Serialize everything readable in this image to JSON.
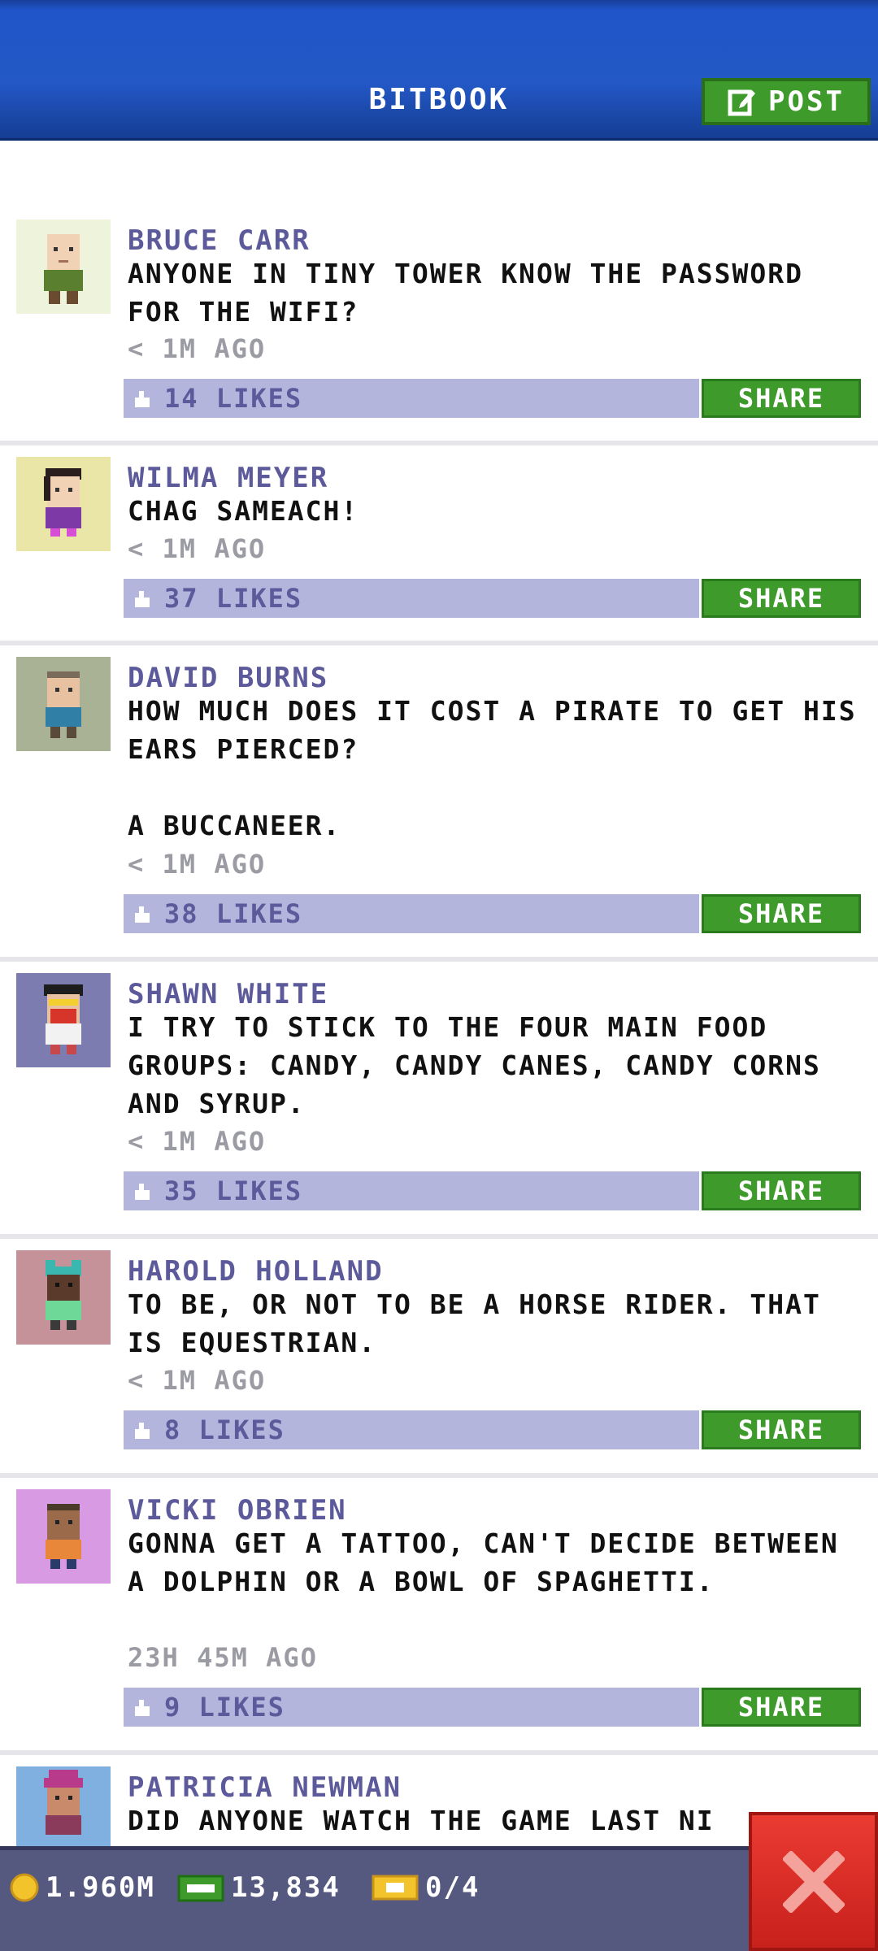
{
  "header": {
    "title": "BITBOOK",
    "post_label": "POST"
  },
  "posts": [
    {
      "name": "BRUCE CARR",
      "text": "ANYONE IN TINY TOWER KNOW THE PASSWORD FOR THE WIFI?",
      "time": "< 1M AGO",
      "likes": "14 LIKES",
      "share": "SHARE"
    },
    {
      "name": "WILMA MEYER",
      "text": "CHAG SAMEACH!",
      "time": "< 1M AGO",
      "likes": "37 LIKES",
      "share": "SHARE"
    },
    {
      "name": "DAVID BURNS",
      "text": "HOW MUCH DOES IT COST A PIRATE TO GET HIS EARS PIERCED?\n\nA BUCCANEER.",
      "time": "< 1M AGO",
      "likes": "38 LIKES",
      "share": "SHARE"
    },
    {
      "name": "SHAWN WHITE",
      "text": "I TRY TO STICK TO THE FOUR MAIN FOOD GROUPS: CANDY, CANDY CANES, CANDY CORNS AND SYRUP.",
      "time": "< 1M AGO",
      "likes": "35 LIKES",
      "share": "SHARE"
    },
    {
      "name": "HAROLD HOLLAND",
      "text": "TO BE, OR NOT TO BE A HORSE RIDER. THAT IS EQUESTRIAN.",
      "time": "< 1M AGO",
      "likes": "8 LIKES",
      "share": "SHARE"
    },
    {
      "name": "VICKI OBRIEN",
      "text": "GONNA GET A TATTOO, CAN'T DECIDE BETWEEN A DOLPHIN OR A BOWL OF SPAGHETTI.",
      "time": "23H 45M AGO",
      "likes": "9 LIKES",
      "share": "SHARE"
    },
    {
      "name": "PATRICIA NEWMAN",
      "text": "DID ANYONE WATCH THE GAME LAST NI"
    }
  ],
  "status": {
    "coins": "1.960M",
    "bux": "13,834",
    "tickets": "0/4"
  },
  "colors": {
    "header_blue": "#2358c6",
    "accent_green": "#3d9a2b",
    "name_purple": "#5d5a9b",
    "like_bar": "#b3b5dc",
    "bottom_bar": "#56597f",
    "close_red": "#e03129"
  },
  "icons": {
    "post": "edit-icon",
    "like": "thumbs-up-icon",
    "coin": "coin-icon",
    "bux": "bux-icon",
    "ticket": "ticket-icon",
    "close": "close-icon"
  }
}
